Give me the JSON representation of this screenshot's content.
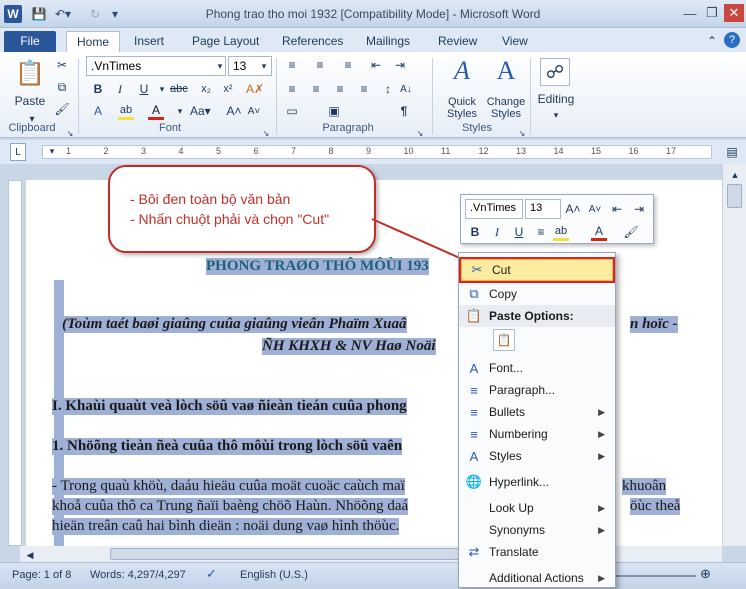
{
  "window": {
    "title": "Phong trao tho moi 1932 [Compatibility Mode]  -  Microsoft Word",
    "app_icon": "W"
  },
  "tabs": [
    "File",
    "Home",
    "Insert",
    "Page Layout",
    "References",
    "Mailings",
    "Review",
    "View"
  ],
  "ribbon": {
    "clipboard": {
      "paste": "Paste",
      "label": "Clipboard"
    },
    "font": {
      "name": ".VnTimes",
      "size": "13",
      "label": "Font"
    },
    "paragraph": {
      "label": "Paragraph"
    },
    "styles": {
      "quick": "Quick Styles",
      "change": "Change Styles",
      "label": "Styles"
    },
    "editing": {
      "label": "Editing"
    }
  },
  "ruler": {
    "marks": [
      "1",
      "2",
      "3",
      "4",
      "5",
      "6",
      "7",
      "8",
      "9",
      "10",
      "11",
      "12",
      "13",
      "14",
      "15",
      "16",
      "17"
    ]
  },
  "document": {
    "title": "PHONG TRAØO THÔ MÔÙI 193",
    "subtitle1": "(Toùm taét baøi giaûng cuûa giaûng vieân Phaïm Xuaâ",
    "subtitle1b": "n hoïc -",
    "subtitle2": "ÑH KHXH & NV Haø Noäi",
    "section1": "I. Khaùi quaùt veà lòch söû vaø ñieàn tieán cuûa phong",
    "section2": "1. Nhöõng tieàn ñeà cuûa thô môùi trong lòch söû vaên",
    "para1a": "- Trong quaù khöù, daáu hieäu cuûa moät cuoäc caùch maï",
    "para1b": "khuoân",
    "para2a": "khoå cuûa thô ca Trung ñaïi baèng chöõ Haùn. Nhöõng daá",
    "para2b": "öùc theå",
    "para3": "hieän treân caû hai bình dieän : noäi dung vaø hình thöùc."
  },
  "callout": {
    "line1": "- Bôi đen toàn bộ văn bản",
    "line2": "- Nhấn chuột phải và chọn \"Cut\""
  },
  "mini_toolbar": {
    "font": ".VnTimes",
    "size": "13"
  },
  "context_menu": {
    "cut": "Cut",
    "copy": "Copy",
    "paste_options": "Paste Options:",
    "font": "Font...",
    "paragraph": "Paragraph...",
    "bullets": "Bullets",
    "numbering": "Numbering",
    "styles": "Styles",
    "hyperlink": "Hyperlink...",
    "look_up": "Look Up",
    "synonyms": "Synonyms",
    "translate": "Translate",
    "additional_actions": "Additional Actions"
  },
  "status": {
    "page": "Page: 1 of 8",
    "words": "Words: 4,297/4,297",
    "language": "English (U.S.)"
  }
}
